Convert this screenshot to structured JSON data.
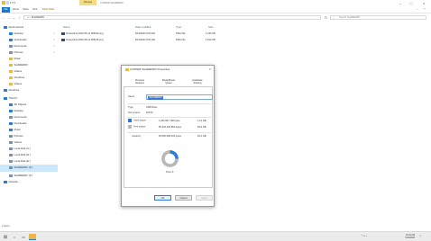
{
  "window": {
    "title": "CASPER SHAREDRV",
    "manage_tab": "Manage",
    "tools_labels": [
      "▾",
      "▾",
      "▾"
    ]
  },
  "ribbon": {
    "file": "File",
    "tabs": [
      "Home",
      "Share",
      "View",
      "Drive Tools"
    ]
  },
  "address": {
    "path": "SHAREDRV",
    "search_placeholder": "Search SHAREDRV"
  },
  "sidebar": {
    "items": [
      {
        "label": "Quick access",
        "icon": "star-icon",
        "color": "#2b7bd3"
      },
      {
        "label": "Desktop",
        "icon": "desktop-icon",
        "color": "#2b7bd3",
        "pinned": true
      },
      {
        "label": "Downloads",
        "icon": "download-icon",
        "color": "#2b7bd3",
        "pinned": true
      },
      {
        "label": "Documents",
        "icon": "document-icon",
        "color": "#7e8ea8",
        "pinned": true
      },
      {
        "label": "Pictures",
        "icon": "picture-icon",
        "color": "#7e8ea8",
        "pinned": true
      },
      {
        "label": "Music",
        "icon": "folder-icon",
        "color": "#e8b94a"
      },
      {
        "label": "SHAREDRV",
        "icon": "folder-icon",
        "color": "#e8b94a"
      },
      {
        "label": "Videos",
        "icon": "folder-icon",
        "color": "#e8b94a"
      },
      {
        "label": "OneDrive",
        "icon": "folder-icon",
        "color": "#e8b94a"
      },
      {
        "label": "Videos",
        "icon": "folder-icon",
        "color": "#e8b94a"
      },
      {
        "label": "OneDrive",
        "icon": "cloud-icon",
        "color": "#2b7bd3"
      },
      {
        "label": "This PC",
        "icon": "computer-icon",
        "color": "#2b7bd3"
      },
      {
        "label": "3D Objects",
        "icon": "cube-icon",
        "color": "#2b7bd3"
      },
      {
        "label": "Desktop",
        "icon": "desktop-icon",
        "color": "#2b7bd3"
      },
      {
        "label": "Documents",
        "icon": "document-icon",
        "color": "#7e8ea8"
      },
      {
        "label": "Downloads",
        "icon": "download-icon",
        "color": "#2b7bd3"
      },
      {
        "label": "Music",
        "icon": "music-icon",
        "color": "#2b7bd3"
      },
      {
        "label": "Pictures",
        "icon": "picture-icon",
        "color": "#7e8ea8"
      },
      {
        "label": "Videos",
        "icon": "video-icon",
        "color": "#7e8ea8"
      },
      {
        "label": "Local Disk (C:)",
        "icon": "drive-icon",
        "color": "#7e8ea8"
      },
      {
        "label": "Local Disk (D:)",
        "icon": "drive-icon",
        "color": "#7e8ea8"
      },
      {
        "label": "Local Disk (E:)",
        "icon": "drive-icon",
        "color": "#7e8ea8"
      },
      {
        "label": "SHAREDRV (F:)",
        "icon": "drive-icon",
        "color": "#7e8ea8",
        "selected": true
      },
      {
        "label": "SHAREDRV (F:)",
        "icon": "drive-icon",
        "color": "#7e8ea8"
      },
      {
        "label": "Network",
        "icon": "network-icon",
        "color": "#2b7bd3"
      }
    ]
  },
  "columns": [
    "Name",
    "Date modified",
    "Type",
    "Size"
  ],
  "files": [
    {
      "name": "Screenshot 2023-05-14 095012.png",
      "date": "5/14/2023 9:50 AM",
      "type": "PNG File",
      "size": "1,234 KB"
    },
    {
      "name": "Screenshot 2023-05-14 095145.png",
      "date": "5/14/2023 9:51 AM",
      "type": "PNG File",
      "size": "1,512 KB"
    }
  ],
  "status": {
    "text": "2 items"
  },
  "dialog": {
    "title": "CASPER SHAREDRV Properties",
    "tabs": [
      {
        "line1": "Previous",
        "line2": "Versions"
      },
      {
        "line1": "ReadyBoost",
        "line2": "Quota"
      },
      {
        "line1": "Hardware",
        "line2": "Sharing"
      }
    ],
    "name_label": "Name:",
    "name_value": "SHAREDRV",
    "type_label": "Type:",
    "type_value": "USB Drive",
    "fs_label": "File system:",
    "fs_value": "FAT32",
    "used_label": "Used space:",
    "used_bytes": "1,234,567,168 bytes",
    "used_size": "1.14 GB",
    "free_label": "Free space:",
    "free_bytes": "65,432,100,864 bytes",
    "free_size": "60.9 GB",
    "cap_label": "Capacity:",
    "cap_bytes": "66,666,668,032 bytes",
    "cap_size": "62.0 GB",
    "drive_label": "Drive F:",
    "used_fraction": 0.25,
    "colors": {
      "used": "#2b7bd3",
      "free": "#b8b8b8"
    },
    "buttons": {
      "ok": "OK",
      "cancel": "Cancel",
      "apply": "Apply"
    }
  },
  "taskbar": {
    "time": "10:11 AM",
    "date": "5/14/2023"
  }
}
